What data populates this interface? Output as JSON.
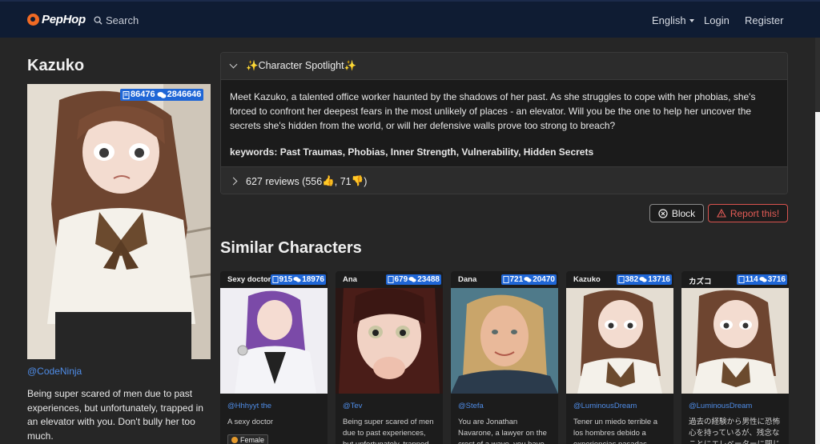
{
  "nav": {
    "brand": "PepHop",
    "search_label": "Search",
    "language": "English",
    "login": "Login",
    "register": "Register"
  },
  "character": {
    "name": "Kazuko",
    "chats": "86476",
    "messages": "2846646",
    "creator": "@CodeNinja",
    "description": "Being super scared of men due to past experiences, but unfortunately, trapped in an elevator with you. Don't bully her too much."
  },
  "spotlight": {
    "header": "✨Character Spotlight✨",
    "body": "Meet Kazuko, a talented office worker haunted by the shadows of her past. As she struggles to cope with her phobias, she's forced to confront her deepest fears in the most unlikely of places - an elevator. Will you be the one to help her uncover the secrets she's hidden from the world, or will her defensive walls prove too strong to breach?",
    "keywords": "keywords: Past Traumas, Phobias, Inner Strength, Vulnerability, Hidden Secrets",
    "reviews_prefix": "627 reviews (556",
    "reviews_mid": ", 71",
    "reviews_suffix": ")"
  },
  "actions": {
    "block": "Block",
    "report": "Report this!"
  },
  "similar": {
    "title": "Similar Characters",
    "cards": [
      {
        "name": "Sexy doctor",
        "chats": "915",
        "messages": "18976",
        "creator": "@Hhhyyt the",
        "desc": "A sexy doctor",
        "tag": "Female"
      },
      {
        "name": "Ana",
        "chats": "679",
        "messages": "23488",
        "creator": "@Tev",
        "desc": "Being super scared of men due to past experiences, but unfortunately, trapped",
        "tag": ""
      },
      {
        "name": "Dana",
        "chats": "721",
        "messages": "20470",
        "creator": "@Stefa",
        "desc": "You are Jonathan Navarone, a lawyer on the crest of a wave, you have",
        "tag": ""
      },
      {
        "name": "Kazuko",
        "chats": "382",
        "messages": "13716",
        "creator": "@LuminousDream",
        "desc": "Tener un miedo terrible a los hombres debido a experiencias pasadas",
        "tag": ""
      },
      {
        "name": "カズコ",
        "chats": "114",
        "messages": "3716",
        "creator": "@LuminousDream",
        "desc": "過去の経験から男性に恐怖心を持っているが、残念なことにエレベーターに閉じ",
        "tag": ""
      }
    ]
  },
  "colors": {
    "navbar": "#0f1c33",
    "accent_blue": "#1f66d6",
    "link_blue": "#4f8de8",
    "report_red": "#d9534f",
    "brand_orange": "#f06a24"
  },
  "icons": {
    "search": "search-icon",
    "chat_count": "document-icon",
    "message_count": "chat-bubbles-icon",
    "block": "circle-x-icon",
    "report": "warning-triangle-icon",
    "thumb_up": "thumb-up-icon",
    "thumb_down": "thumb-down-icon"
  }
}
